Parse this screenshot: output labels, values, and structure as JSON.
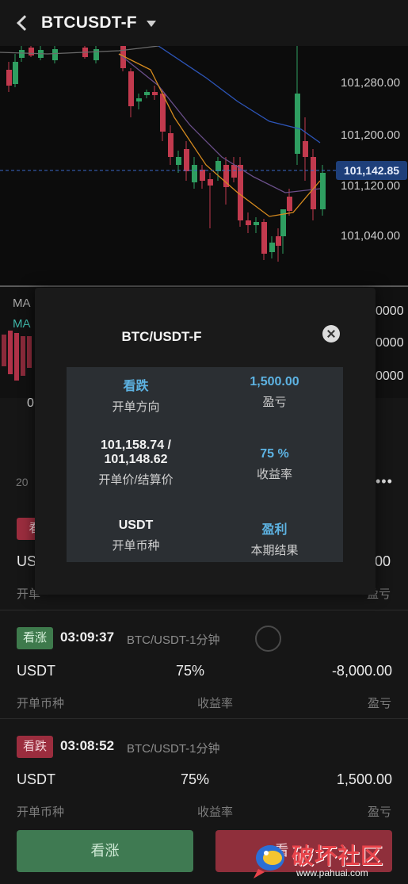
{
  "header": {
    "symbol": "BTCUSDT-F"
  },
  "chart": {
    "price_labels": [
      "101,280.00",
      "101,200.00",
      "101,120.00",
      "101,040.00"
    ],
    "current_price": "101,142.85",
    "indicator_labels": [
      "MA",
      "MA"
    ],
    "volume_labels": [
      "0000",
      "0000",
      "0000"
    ]
  },
  "modal": {
    "title": "BTC/USDT-F",
    "direction_value": "看跌",
    "direction_label": "开单方向",
    "pnl_value": "1,500.00",
    "pnl_label": "盈亏",
    "price_value_1": "101,158.74 /",
    "price_value_2": "101,148.62",
    "price_label": "开单价/结算价",
    "rate_value": "75 %",
    "rate_label": "收益率",
    "currency_value": "USDT",
    "currency_label": "开单币种",
    "result_value": "盈利",
    "result_label": "本期结果"
  },
  "background": {
    "date_fragment": "20",
    "side_left_1": "0",
    "side_left_2": "",
    "first_order": {
      "badge": "看",
      "currency": "US",
      "currency_label": "开单",
      "pnl": "00",
      "pnl_label": "盈亏"
    }
  },
  "orders": [
    {
      "direction": "看涨",
      "type": "up",
      "time": "03:09:37",
      "pair": "BTC/USDT-1分钟",
      "currency": "USDT",
      "rate": "75%",
      "pnl": "-8,000.00",
      "currency_label": "开单币种",
      "rate_label": "收益率",
      "pnl_label": "盈亏"
    },
    {
      "direction": "看跌",
      "type": "down",
      "time": "03:08:52",
      "pair": "BTC/USDT-1分钟",
      "currency": "USDT",
      "rate": "75%",
      "pnl": "1,500.00",
      "currency_label": "开单币种",
      "rate_label": "收益率",
      "pnl_label": "盈亏"
    }
  ],
  "buttons": {
    "up_label": "看涨",
    "down_label": "看"
  },
  "watermark": {
    "text": "破坏社区",
    "url": "www.pahuai.com"
  },
  "colors": {
    "up": "#3f7a52",
    "down": "#8f2f3b",
    "accent_blue": "#5db3e3"
  }
}
